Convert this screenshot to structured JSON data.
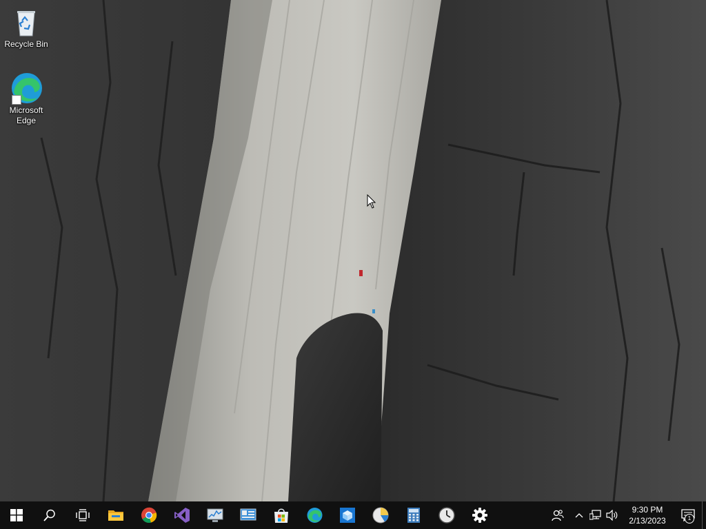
{
  "desktop": {
    "icons": [
      {
        "label": "Recycle Bin",
        "icon": "recycle-bin-icon"
      },
      {
        "label": "Microsoft Edge",
        "icon": "edge-icon"
      }
    ]
  },
  "taskbar": {
    "pinned": [
      {
        "name": "start",
        "icon": "windows-logo-icon"
      },
      {
        "name": "search",
        "icon": "search-icon"
      },
      {
        "name": "task-view",
        "icon": "task-view-icon"
      },
      {
        "name": "file-explorer",
        "icon": "folder-icon"
      },
      {
        "name": "chrome",
        "icon": "chrome-icon"
      },
      {
        "name": "visual-studio",
        "icon": "visual-studio-icon"
      },
      {
        "name": "performance-monitor",
        "icon": "performance-monitor-icon"
      },
      {
        "name": "system-information",
        "icon": "system-information-icon"
      },
      {
        "name": "microsoft-store",
        "icon": "store-icon"
      },
      {
        "name": "edge",
        "icon": "edge-icon"
      },
      {
        "name": "virtualbox",
        "icon": "box-icon"
      },
      {
        "name": "disk-usage",
        "icon": "pie-chart-icon"
      },
      {
        "name": "calculator",
        "icon": "calculator-icon"
      },
      {
        "name": "clock",
        "icon": "clock-icon"
      },
      {
        "name": "settings",
        "icon": "gear-icon"
      }
    ],
    "tray": {
      "time": "9:30 PM",
      "date": "2/13/2023",
      "notification_count": "1"
    }
  },
  "colors": {
    "taskbar_bg": "#101010",
    "accent": "#0078d7"
  }
}
